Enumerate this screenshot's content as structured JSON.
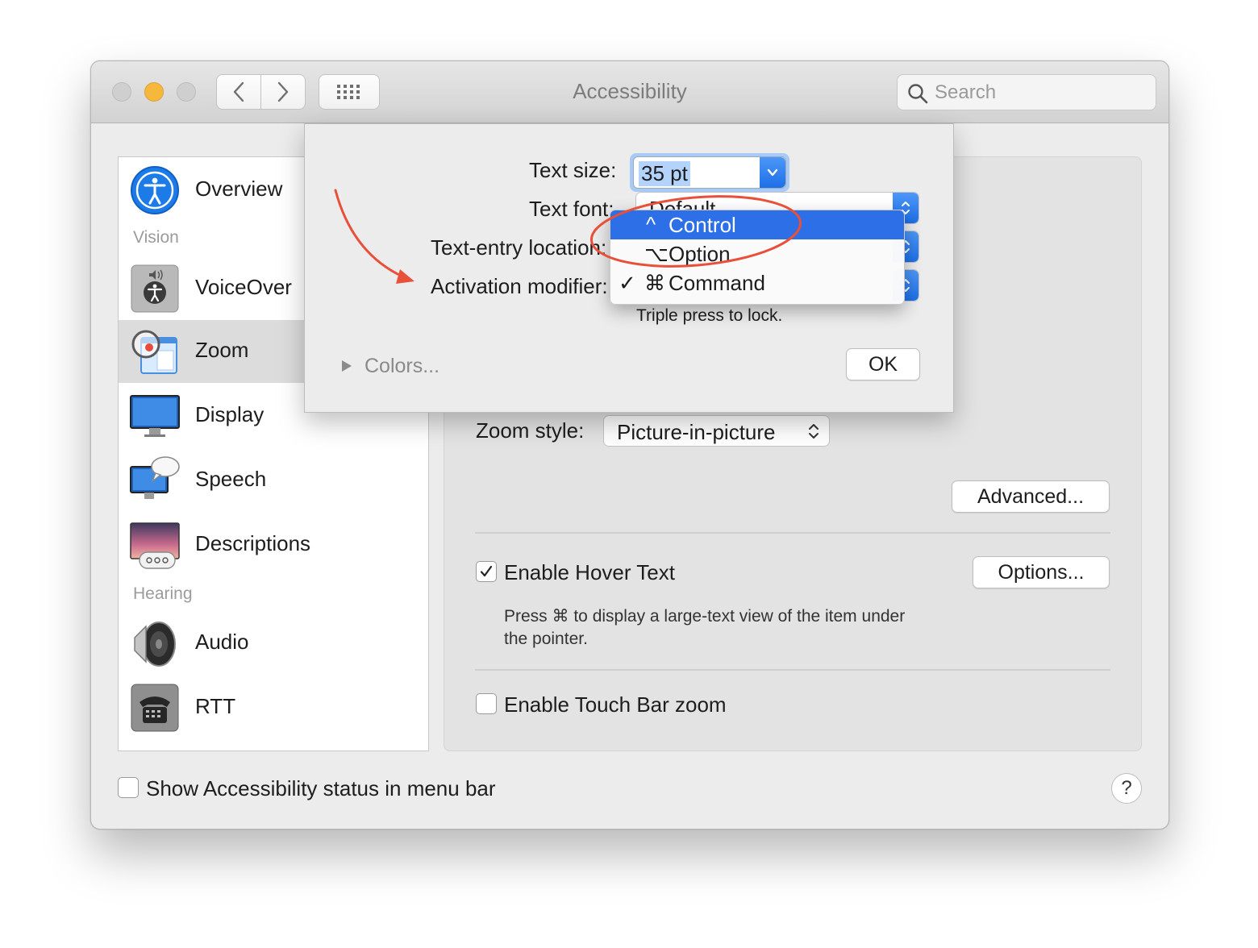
{
  "window": {
    "title": "Accessibility",
    "search_placeholder": "Search"
  },
  "sidebar": {
    "items": [
      {
        "label": "Overview"
      },
      {
        "header": "Vision"
      },
      {
        "label": "VoiceOver"
      },
      {
        "label": "Zoom",
        "selected": true
      },
      {
        "label": "Display"
      },
      {
        "label": "Speech"
      },
      {
        "label": "Descriptions"
      },
      {
        "header": "Hearing"
      },
      {
        "label": "Audio"
      },
      {
        "label": "RTT"
      }
    ]
  },
  "zoom_panel": {
    "zoom_style_label": "Zoom style:",
    "zoom_style_value": "Picture-in-picture",
    "advanced_button": "Advanced...",
    "hover_text_label": "Enable Hover Text",
    "hover_text_checked": true,
    "options_button": "Options...",
    "hover_text_desc_line1": "Press ⌘ to display a large-text view of the item under",
    "hover_text_desc_line2": "the pointer.",
    "touch_bar_label": "Enable Touch Bar zoom",
    "touch_bar_checked": false
  },
  "footer": {
    "status_menu_label": "Show Accessibility status in menu bar",
    "status_menu_checked": false,
    "help_label": "?"
  },
  "sheet": {
    "text_size_label": "Text size:",
    "text_size_value": "35 pt",
    "text_font_label": "Text font:",
    "text_font_value": "Default",
    "text_entry_label": "Text-entry location:",
    "activation_label": "Activation modifier:",
    "triple_press_note": "Triple press to lock.",
    "colors_label": "Colors...",
    "ok_button": "OK"
  },
  "modifier_menu": {
    "items": [
      {
        "glyph": "^",
        "label": "Control",
        "highlighted": true,
        "checked": false
      },
      {
        "glyph": "⌥",
        "label": "Option",
        "highlighted": false,
        "checked": false
      },
      {
        "glyph": "⌘",
        "label": "Command",
        "highlighted": false,
        "checked": true
      }
    ],
    "checkmark": "✓"
  },
  "colors": {
    "accent": "#2c6fe6",
    "annotation": "#e8503a",
    "traffic_close": "#cfcfcf",
    "traffic_minimize": "#f5b83c",
    "traffic_zoom": "#cfcfcf"
  }
}
